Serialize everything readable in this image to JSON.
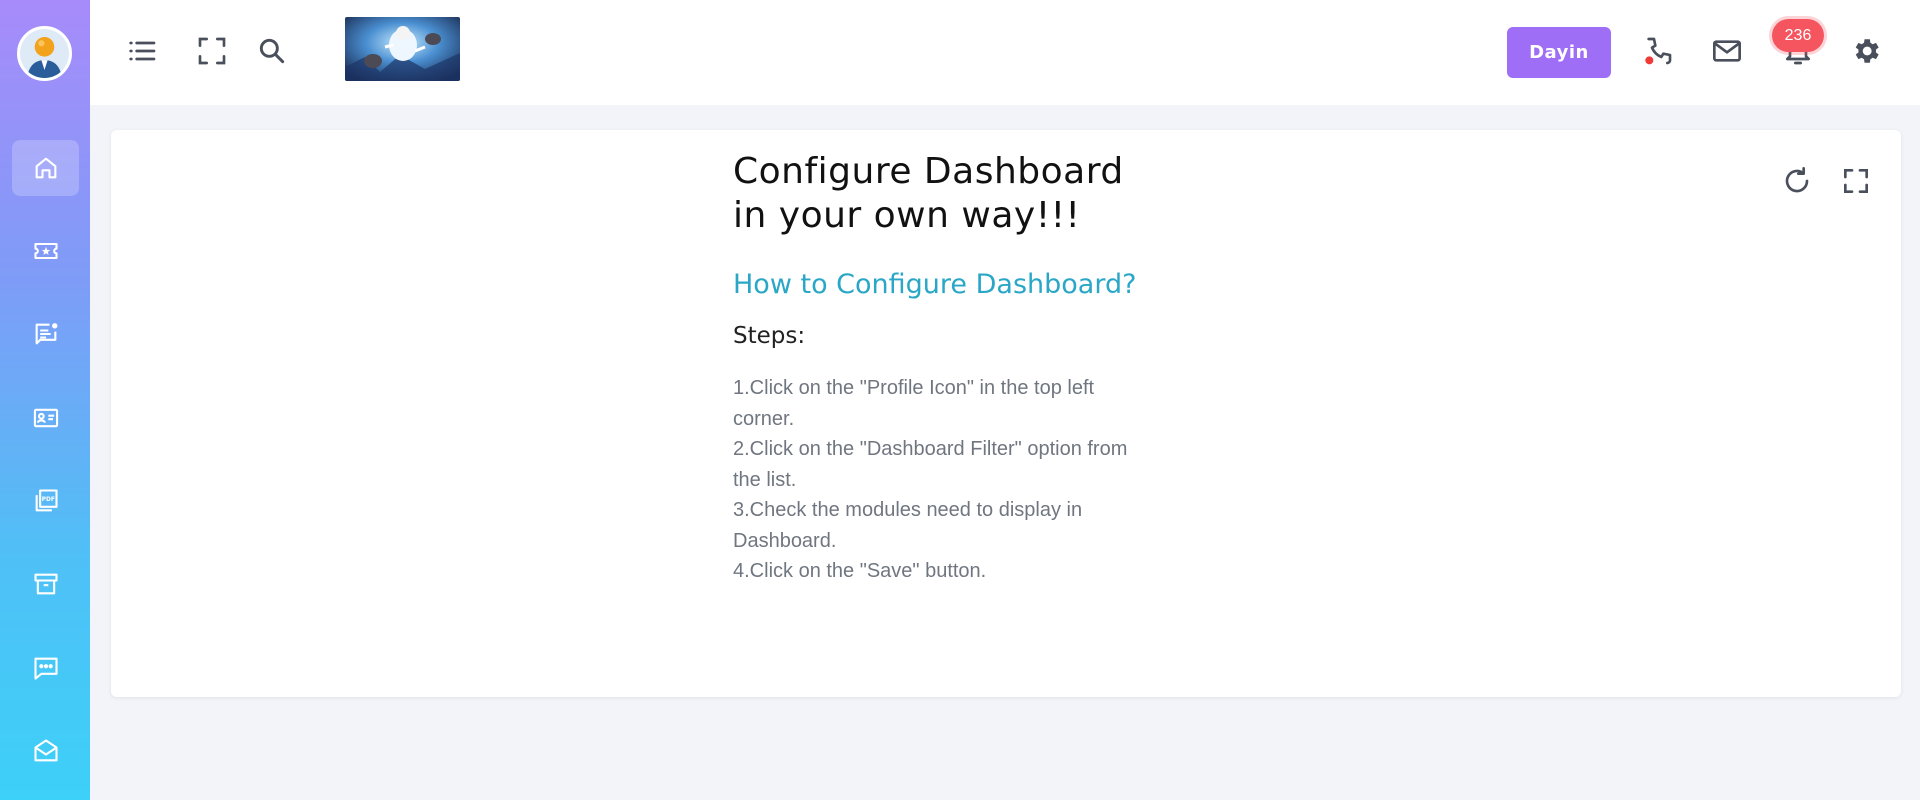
{
  "sidebar": {
    "avatar_icon": "user-avatar-icon",
    "items": [
      {
        "name": "home",
        "icon": "home-icon",
        "active": true
      },
      {
        "name": "tickets",
        "icon": "ticket-star-icon"
      },
      {
        "name": "notes",
        "icon": "notes-notification-icon"
      },
      {
        "name": "contacts",
        "icon": "contact-card-icon"
      },
      {
        "name": "pdf",
        "icon": "pdf-files-icon"
      },
      {
        "name": "archive",
        "icon": "archive-box-icon"
      },
      {
        "name": "chat",
        "icon": "chat-bubble-icon"
      },
      {
        "name": "mail",
        "icon": "open-envelope-icon"
      }
    ]
  },
  "header": {
    "dayin_label": "Dayin",
    "notification_count": "236",
    "icons": [
      "list-menu-icon",
      "fullscreen-icon",
      "search-icon",
      "phone-icon",
      "mail-icon",
      "bell-icon",
      "gear-icon"
    ]
  },
  "card": {
    "title": "Configure Dashboard in your own way!!!",
    "subtitle": "How to Configure Dashboard?",
    "steps_label": "Steps:",
    "steps": [
      "1.Click on the \"Profile Icon\" in the top left corner.",
      "2.Click on the \"Dashboard Filter\" option from the list.",
      "3.Check the modules need to display in Dashboard.",
      "4.Click on the \"Save\" button."
    ]
  },
  "colors": {
    "accent": "#9f6ef7",
    "subtitle": "#2aa7c7",
    "badge": "#f5555f",
    "phone_status": "#f03a3a"
  }
}
